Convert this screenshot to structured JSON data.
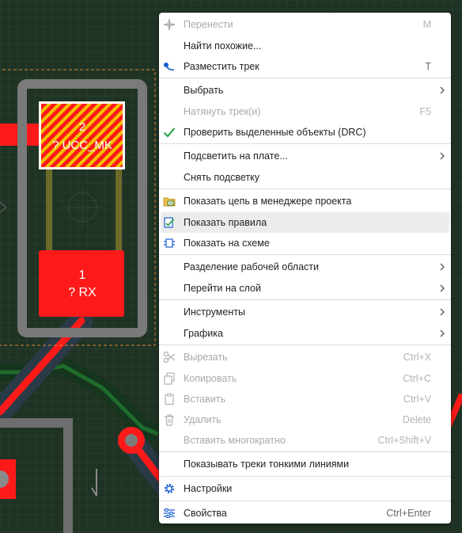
{
  "pcb": {
    "pad_top": {
      "number": "2",
      "net": "? UCC_MK"
    },
    "pad_bottom": {
      "number": "1",
      "net": "? RX"
    }
  },
  "colors": {
    "board": "#1f3324",
    "track_red": "#ff1a1a",
    "track_green": "#1f6b2c",
    "selection": "#d98a3a",
    "menu_bg": "#ffffff",
    "highlight": "#ececec"
  },
  "menu": {
    "items": [
      {
        "label": "Перенести",
        "shortcut": "M",
        "icon": "move-icon",
        "disabled": true
      },
      {
        "label": "Найти похожие...",
        "shortcut": "",
        "icon": "",
        "disabled": false
      },
      {
        "label": "Разместить трек",
        "shortcut": "T",
        "icon": "route-track-icon",
        "disabled": false
      },
      {
        "label": "Выбрать",
        "shortcut": "",
        "icon": "",
        "disabled": false,
        "submenu": true
      },
      {
        "label": "Натянуть трек(и)",
        "shortcut": "F5",
        "icon": "",
        "disabled": true
      },
      {
        "label": "Проверить выделенные объекты (DRC)",
        "shortcut": "",
        "icon": "check-icon",
        "disabled": false
      },
      {
        "label": "Подсветить на плате...",
        "shortcut": "",
        "icon": "",
        "disabled": false,
        "submenu": true
      },
      {
        "label": "Снять подсветку",
        "shortcut": "",
        "icon": "",
        "disabled": false
      },
      {
        "label": "Показать цепь в менеджере проекта",
        "shortcut": "",
        "icon": "net-manager-icon",
        "disabled": false
      },
      {
        "label": "Показать правила",
        "shortcut": "",
        "icon": "rules-icon",
        "disabled": false,
        "highlighted": true
      },
      {
        "label": "Показать на схеме",
        "shortcut": "",
        "icon": "schematic-icon",
        "disabled": false
      },
      {
        "label": "Разделение рабочей области",
        "shortcut": "",
        "icon": "",
        "disabled": false,
        "submenu": true
      },
      {
        "label": "Перейти на слой",
        "shortcut": "",
        "icon": "",
        "disabled": false,
        "submenu": true
      },
      {
        "label": "Инструменты",
        "shortcut": "",
        "icon": "",
        "disabled": false,
        "submenu": true
      },
      {
        "label": "Графика",
        "shortcut": "",
        "icon": "",
        "disabled": false,
        "submenu": true
      },
      {
        "label": "Вырезать",
        "shortcut": "Ctrl+X",
        "icon": "scissors-icon",
        "disabled": true
      },
      {
        "label": "Копировать",
        "shortcut": "Ctrl+C",
        "icon": "copy-icon",
        "disabled": true
      },
      {
        "label": "Вставить",
        "shortcut": "Ctrl+V",
        "icon": "paste-icon",
        "disabled": true
      },
      {
        "label": "Удалить",
        "shortcut": "Delete",
        "icon": "trash-icon",
        "disabled": true
      },
      {
        "label": "Вставить многократно",
        "shortcut": "Ctrl+Shift+V",
        "icon": "",
        "disabled": true
      },
      {
        "label": "Показывать треки тонкими линиями",
        "shortcut": "",
        "icon": "",
        "disabled": false
      },
      {
        "label": "Настройки",
        "shortcut": "",
        "icon": "gear-icon",
        "disabled": false
      },
      {
        "label": "Свойства",
        "shortcut": "Ctrl+Enter",
        "icon": "properties-icon",
        "disabled": false
      }
    ]
  }
}
